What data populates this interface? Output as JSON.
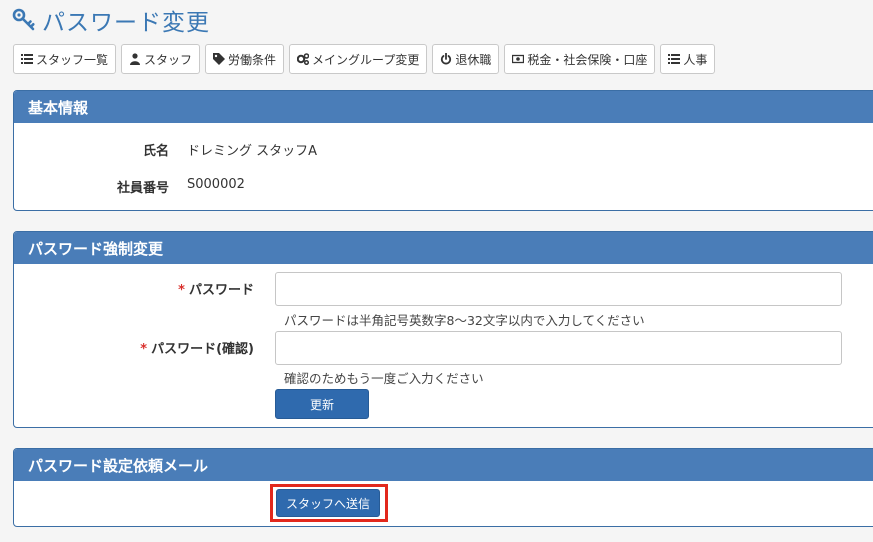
{
  "header": {
    "title": "パスワード変更",
    "icon": "key-icon"
  },
  "toolbar": [
    {
      "label": "スタッフ一覧",
      "icon": "list-icon"
    },
    {
      "label": "スタッフ",
      "icon": "user-icon"
    },
    {
      "label": "労働条件",
      "icon": "tag-icon"
    },
    {
      "label": "メイングループ変更",
      "icon": "cogs-icon"
    },
    {
      "label": "退休職",
      "icon": "power-icon"
    },
    {
      "label": "税金・社会保険・口座",
      "icon": "money-icon"
    },
    {
      "label": "人事",
      "icon": "list-icon"
    }
  ],
  "basic_info": {
    "heading": "基本情報",
    "name_label": "氏名",
    "name_value": "ドレミング スタッフA",
    "number_label": "社員番号",
    "number_value": "S000002"
  },
  "force_change": {
    "heading": "パスワード強制変更",
    "required_mark": "*",
    "password_label": "パスワード",
    "password_value": "",
    "password_help": "パスワードは半角記号英数字8〜32文字以内で入力してください",
    "confirm_label": "パスワード(確認)",
    "confirm_value": "",
    "confirm_help": "確認のためもう一度ご入力ください",
    "update_button": "更新"
  },
  "request_mail": {
    "heading": "パスワード設定依頼メール",
    "send_button": "スタッフへ送信"
  },
  "colors": {
    "accent": "#3b78b4",
    "panel_heading": "#4a7db8",
    "primary_button": "#2f6aae",
    "required": "#d9302c",
    "highlight": "#e2281c"
  }
}
